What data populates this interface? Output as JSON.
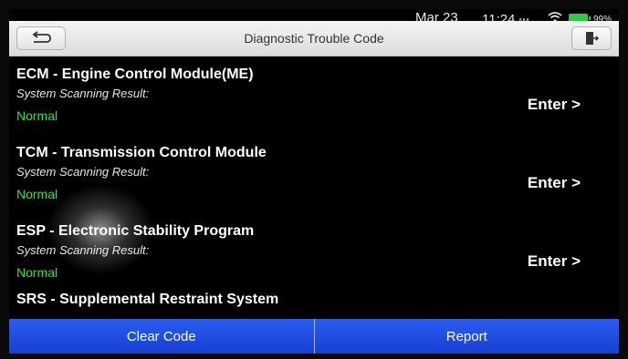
{
  "status_bar": {
    "date": "Mar 23",
    "time": "11:24",
    "ampm": "AM",
    "battery": "99%"
  },
  "header": {
    "title": "Diagnostic Trouble Code",
    "back_icon": "back-arrow-icon",
    "exit_icon": "exit-door-icon"
  },
  "modules": [
    {
      "name": "ECM - Engine Control Module(ME)",
      "sub": "System Scanning Result:",
      "result": "Normal",
      "action": "Enter >"
    },
    {
      "name": "TCM - Transmission Control Module",
      "sub": "System Scanning Result:",
      "result": "Normal",
      "action": "Enter >"
    },
    {
      "name": "ESP - Electronic Stability Program",
      "sub": "System Scanning Result:",
      "result": "Normal",
      "action": "Enter >"
    },
    {
      "name": "SRS - Supplemental Restraint System"
    }
  ],
  "footer": {
    "clear_label": "Clear Code",
    "report_label": "Report"
  },
  "colors": {
    "accent": "#1b48e0",
    "normal": "#33e04a"
  }
}
